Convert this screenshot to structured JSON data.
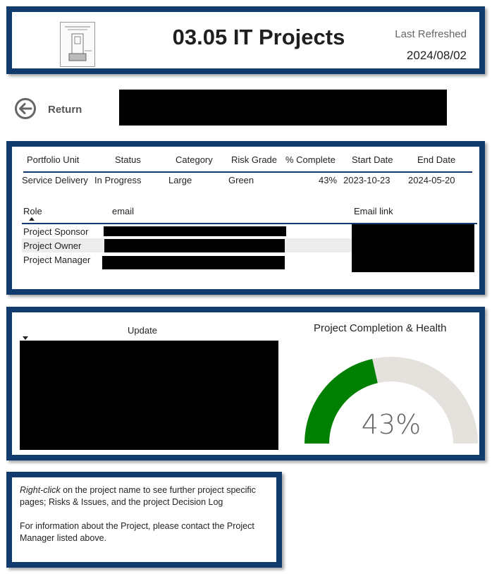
{
  "header": {
    "title": "03.05 IT Projects",
    "refreshed_label": "Last Refreshed",
    "refreshed_date": "2024/08/02"
  },
  "nav": {
    "return_label": "Return"
  },
  "project_table": {
    "columns": [
      "Portfolio Unit",
      "Status",
      "Category",
      "Risk Grade",
      "% Complete",
      "Start Date",
      "End Date"
    ],
    "row": [
      "Service Delivery",
      "In Progress",
      "Large",
      "Green",
      "43%",
      "2023-10-23",
      "2024-05-20"
    ]
  },
  "contacts_table": {
    "columns": [
      "Role",
      "email",
      "Email link"
    ],
    "roles": [
      "Project Sponsor",
      "Project Owner",
      "Project Manager"
    ]
  },
  "updates": {
    "column_label": "Update"
  },
  "gauge": {
    "title": "Project Completion & Health",
    "value_label": "43%",
    "fraction": 0.43,
    "fill_color": "#008000",
    "track_color": "#e5e1dc"
  },
  "note": {
    "line1_em": "Right-click",
    "line1_rest": " on the project name to see further project specific pages; Risks & Issues, and the project Decision Log",
    "line2": "For information about the Project, please contact the Project Manager listed above."
  }
}
